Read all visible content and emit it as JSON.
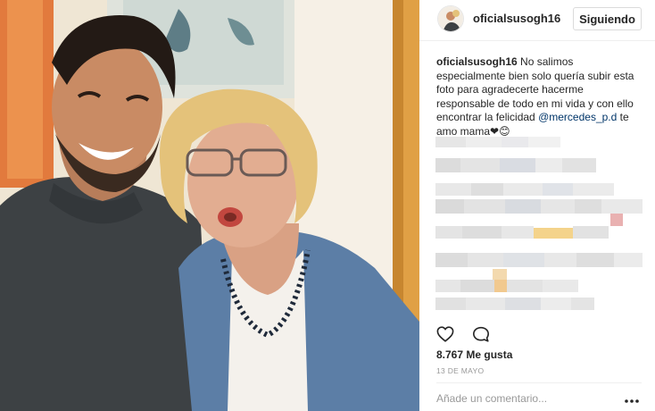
{
  "post": {
    "username": "oficialsusogh16",
    "follow_button_label": "Siguiendo",
    "caption_username": "oficialsusogh16",
    "caption_text": " No salimos especialmente bien solo quería subir esta foto para agradecerte hacerme responsable de todo en mi vida y con ello encontrar la felicidad ",
    "caption_mention": "@mercedes_p.d",
    "caption_end": " te amo mama❤😊",
    "likes": "8.767 Me gusta",
    "date": "13 DE MAYO",
    "comment_placeholder": "Añade un comentario...",
    "more_options_glyph": "•••"
  },
  "icons": {
    "like": "heart-icon",
    "comment": "comment-icon",
    "more": "more-options-icon"
  },
  "colors": {
    "mention": "#003569",
    "muted": "#999999",
    "text": "#262626",
    "border": "#dbdbdb"
  }
}
